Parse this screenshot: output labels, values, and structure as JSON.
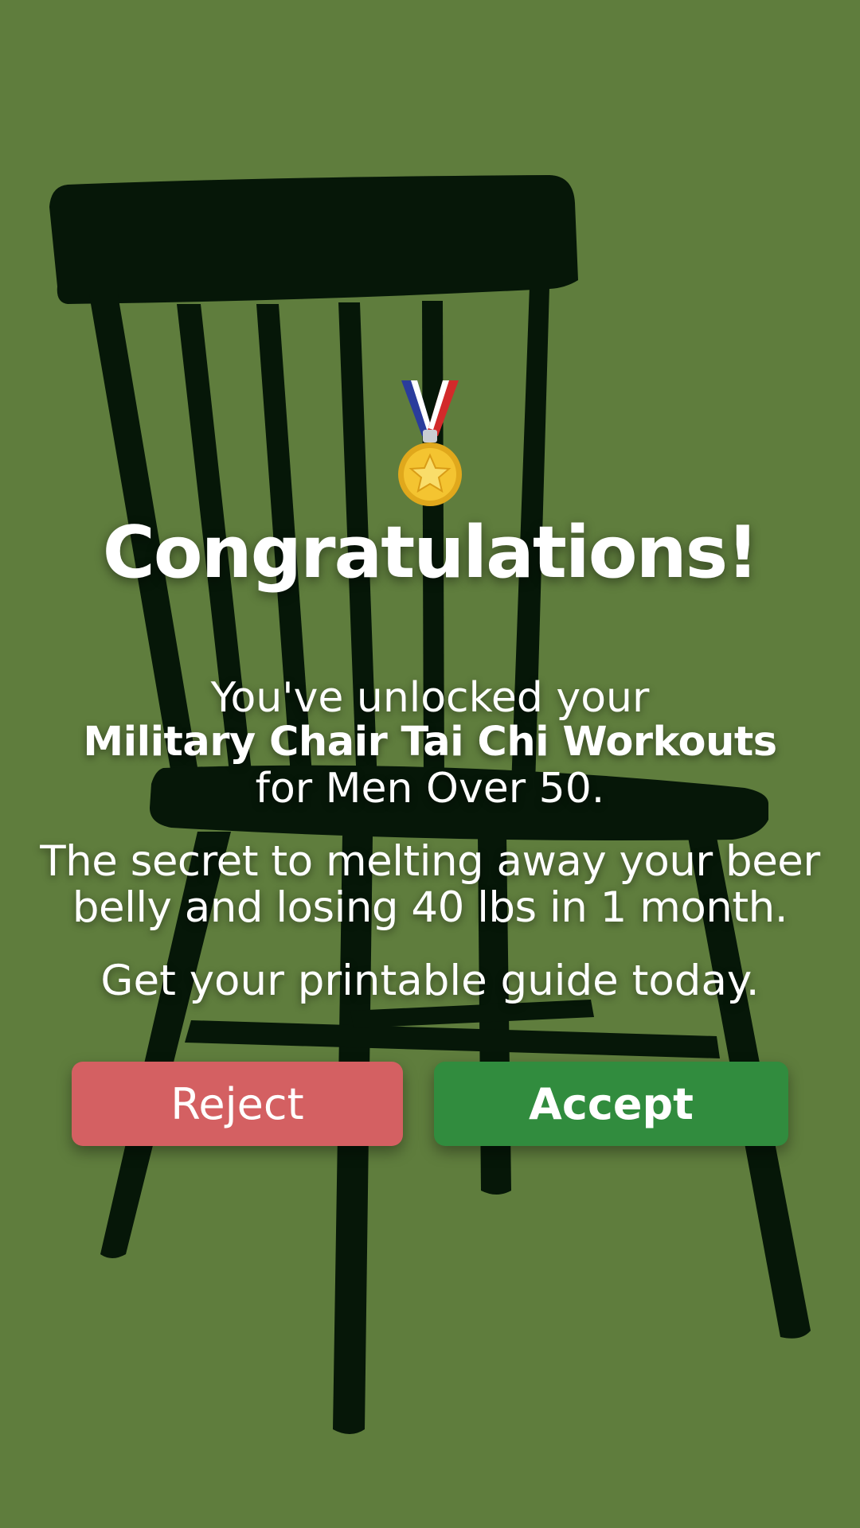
{
  "colors": {
    "background": "#5f7d3d",
    "chair_silhouette": "#061708",
    "reject": "#d46062",
    "accept": "#318c3e",
    "text": "#ffffff"
  },
  "icons": {
    "medal": "sports-medal-icon",
    "background": "chair-silhouette"
  },
  "title": "Congratulations!",
  "unlock": {
    "line1": "You've unlocked your",
    "line2": "Military Chair Tai Chi Workouts",
    "line3": "for Men Over 50."
  },
  "secret": {
    "line1": "The secret to melting away your beer",
    "line2": "belly and losing 40 lbs in 1 month."
  },
  "guide": "Get your printable guide today.",
  "buttons": {
    "reject": "Reject",
    "accept": "Accept"
  }
}
